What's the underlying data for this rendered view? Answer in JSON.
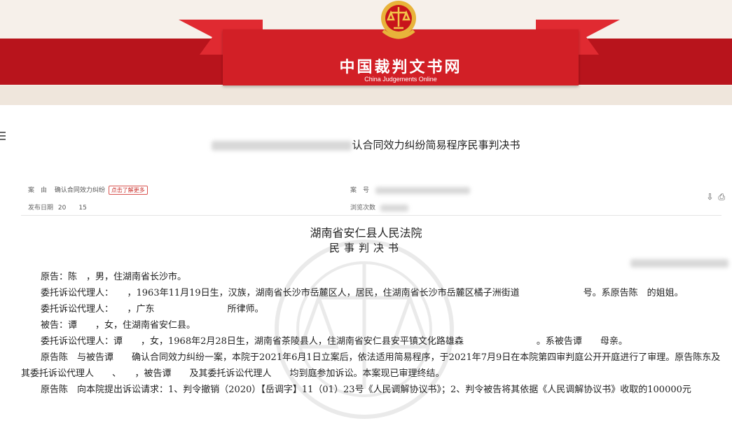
{
  "site": {
    "title": "中国裁判文书网",
    "subtitle": "China Judgements Online"
  },
  "document": {
    "title": "认合同效力纠纷简易程序民事判决书",
    "meta": {
      "cause_label": "案　由",
      "cause_value": "确认合同效力纠纷",
      "learn_more": "点击了解更多",
      "case_no_label": "案　号",
      "publish_label": "发布日期",
      "publish_value": "20　　15",
      "views_label": "浏览次数"
    },
    "court": "湖南省安仁县人民法院",
    "doc_type": "民事判决书",
    "paragraphs": [
      "原告：陈　，男，住湖南省长沙市。",
      "委托诉讼代理人：　　，1963年11月19日生，汉族，湖南省长沙市岳麓区人，居民，住湖南省长沙市岳麓区橘子洲街道　　　　　　　号。系原告陈　的姐姐。",
      "委托诉讼代理人：　　，广东　　　　　　　　所律师。",
      "被告：谭　　，女，住湖南省安仁县。",
      "委托诉讼代理人：谭　　，女，1968年2月28日生，湖南省茶陵县人，住湖南省安仁县安平镇文化路雄森　　　　　　　　。系被告谭　　母亲。",
      "原告陈　与被告谭　　确认合同效力纠纷一案，本院于2021年6月1日立案后，依法适用简易程序，于2021年7月9日在本院第四审判庭公开开庭进行了审理。原告陈东及其委托诉讼代理人　　、　　，被告谭　　及其委托诉讼代理人　　均到庭参加诉讼。本案现已审理终结。",
      "原告陈　向本院提出诉讼请求：1、判令撤销（2020）【岳调字】11（01）23号《人民调解协议书》；2、判令被告将其依据《人民调解协议书》收取的100000元"
    ]
  },
  "toolbar": {
    "print_icon": "print-icon",
    "download_icon": "download-icon"
  },
  "colors": {
    "banner_red": "#b8141c",
    "ribbon_red": "#e02a31",
    "center_red": "#d21f26",
    "emblem_gold": "#e8b33a",
    "learn_more_red": "#c9302c"
  }
}
